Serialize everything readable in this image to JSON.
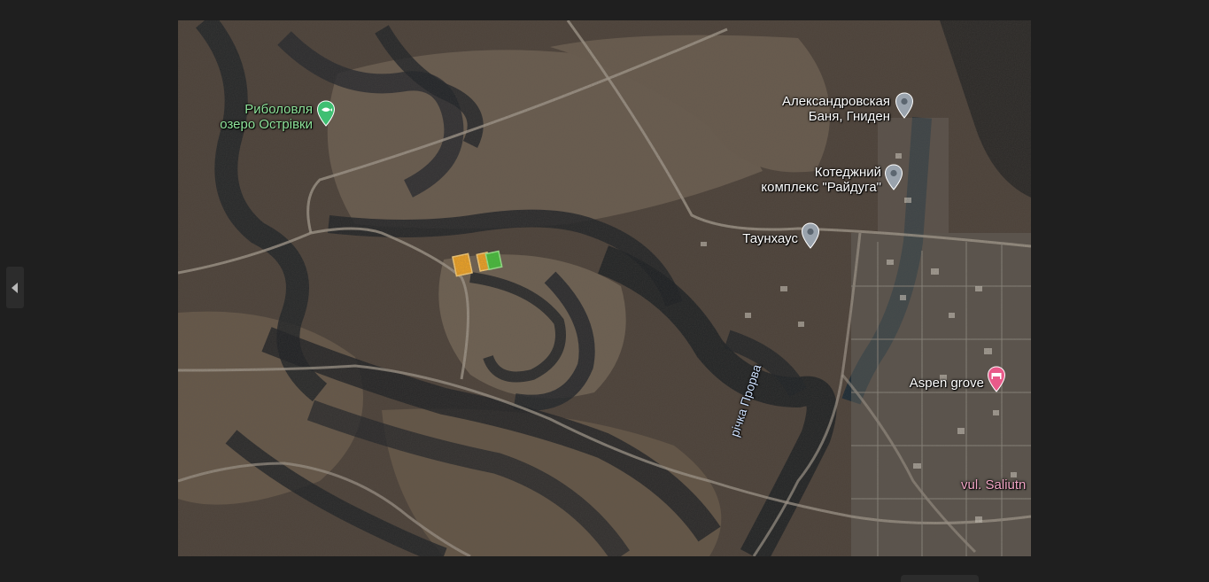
{
  "navigation": {
    "prev_icon": "chevron-left-icon"
  },
  "map": {
    "type": "satellite",
    "places": [
      {
        "name_line1": "Риболовля",
        "name_line2": "озеро Острівки",
        "icon": "fishing-pin-icon",
        "color": "#3fbf72"
      },
      {
        "name_line1": "Александровская",
        "name_line2": "Баня, Гниден",
        "icon": "location-pin-icon",
        "color": "#9aa3ad"
      },
      {
        "name_line1": "Котеджний",
        "name_line2": "комплекс \"Райдуга\"",
        "icon": "location-pin-icon",
        "color": "#9aa3ad"
      },
      {
        "name_line1": "Таунхаус",
        "icon": "location-pin-icon",
        "color": "#9aa3ad"
      },
      {
        "name_line1": "Aspen grove",
        "icon": "hotel-pin-icon",
        "color": "#e85a8a"
      }
    ],
    "river_label": "річка Прорва",
    "street_label": "vul. Saliutn",
    "plots": [
      {
        "color": "#f5a623",
        "name": "plot-orange-1"
      },
      {
        "color": "#f5a623",
        "name": "plot-orange-2"
      },
      {
        "color": "#46c43a",
        "name": "plot-green"
      }
    ]
  }
}
